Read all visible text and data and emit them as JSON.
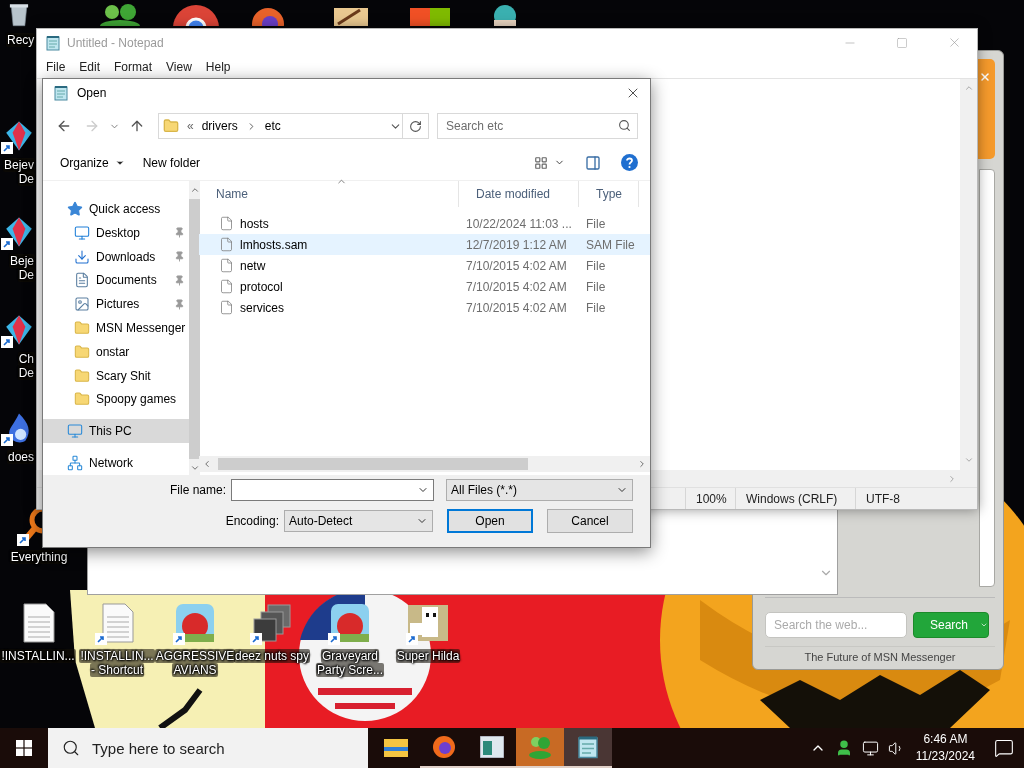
{
  "desktop": {
    "icons": [
      {
        "kind": "recycle",
        "shortcut": false,
        "lines": [
          "Recy"
        ]
      },
      {
        "kind": "gem",
        "shortcut": true,
        "lines": [
          "Bejev",
          "De"
        ]
      },
      {
        "kind": "gem",
        "shortcut": true,
        "lines": [
          "Beje",
          "De"
        ]
      },
      {
        "kind": "gem",
        "shortcut": true,
        "lines": [
          "Ch",
          "De"
        ]
      },
      {
        "kind": "flame",
        "shortcut": true,
        "lines": [
          "does"
        ]
      },
      {
        "kind": "search",
        "shortcut": true,
        "lines": [
          "Everything"
        ]
      },
      {
        "kind": "document",
        "shortcut": false,
        "lines": [
          "!INSTALLIN..."
        ]
      },
      {
        "kind": "document",
        "shortcut": true,
        "lines": [
          "!INSTALLIN...",
          "- Shortcut"
        ]
      },
      {
        "kind": "game",
        "shortcut": true,
        "lines": [
          "AGGRESSIVE",
          "AVIANS"
        ]
      },
      {
        "kind": "stack",
        "shortcut": true,
        "lines": [
          "deez nuts spy"
        ]
      },
      {
        "kind": "game",
        "shortcut": true,
        "lines": [
          "Graveyard",
          "Party Scre..."
        ]
      },
      {
        "kind": "pixel",
        "shortcut": true,
        "lines": [
          "Super Hilda"
        ]
      }
    ]
  },
  "msn_window": {
    "search": {
      "placeholder": "Search the web..."
    },
    "search_button": "Search",
    "footer": "The Future of MSN Messenger"
  },
  "notepad": {
    "title": "Untitled - Notepad",
    "active": false,
    "menu": [
      "File",
      "Edit",
      "Format",
      "View",
      "Help"
    ],
    "status_bar": [
      "100%",
      "Windows (CRLF)",
      "UTF-8"
    ]
  },
  "open_dialog": {
    "title": "Open",
    "address": {
      "overflow_mark": "«",
      "crumbs": [
        "drivers",
        "etc"
      ]
    },
    "search": {
      "placeholder": "Search etc"
    },
    "toolbar": {
      "organize": "Organize",
      "new_folder": "New folder"
    },
    "nav": [
      {
        "label": "Quick access",
        "kind": "star",
        "selected": false,
        "children": [
          {
            "label": "Desktop",
            "kind": "desktop",
            "pinned": true,
            "selected": false
          },
          {
            "label": "Downloads",
            "kind": "download",
            "pinned": true,
            "selected": false
          },
          {
            "label": "Documents",
            "kind": "document",
            "pinned": true,
            "selected": false
          },
          {
            "label": "Pictures",
            "kind": "picture",
            "pinned": true,
            "selected": false
          },
          {
            "label": "MSN Messenger",
            "kind": "folder",
            "pinned": false,
            "selected": false
          },
          {
            "label": "onstar",
            "kind": "folder",
            "pinned": false,
            "selected": false
          },
          {
            "label": "Scary Shit",
            "kind": "folder",
            "pinned": false,
            "selected": false
          },
          {
            "label": "Spoopy games",
            "kind": "folder",
            "pinned": false,
            "selected": false
          }
        ]
      },
      {
        "label": "This PC",
        "kind": "pc",
        "selected": true
      },
      {
        "label": "Network",
        "kind": "network",
        "selected": false
      }
    ],
    "columns": [
      "Name",
      "Date modified",
      "Type"
    ],
    "files": [
      {
        "name": "hosts",
        "date": "10/22/2024 11:03 ...",
        "type": "File",
        "hovered": false
      },
      {
        "name": "lmhosts.sam",
        "date": "12/7/2019 1:12 AM",
        "type": "SAM File",
        "hovered": true
      },
      {
        "name": "netw",
        "date": "7/10/2015 4:02 AM",
        "type": "File",
        "hovered": false
      },
      {
        "name": "protocol",
        "date": "7/10/2015 4:02 AM",
        "type": "File",
        "hovered": false
      },
      {
        "name": "services",
        "date": "7/10/2015 4:02 AM",
        "type": "File",
        "hovered": false
      }
    ],
    "file_name_label": "File name:",
    "filter": "All Files (*.*)",
    "encoding_label": "Encoding:",
    "encoding": "Auto-Detect",
    "buttons": [
      "Open",
      "Cancel"
    ]
  },
  "taskbar": {
    "search_placeholder": "Type here to search",
    "apps": [
      {
        "kind": "explorer",
        "running": false,
        "active": false,
        "flashing": false
      },
      {
        "kind": "firefox",
        "running": true,
        "active": false,
        "flashing": false
      },
      {
        "kind": "app",
        "running": true,
        "active": false,
        "flashing": false
      },
      {
        "kind": "msn",
        "running": true,
        "active": false,
        "flashing": true
      },
      {
        "kind": "notepad",
        "running": true,
        "active": true,
        "flashing": false
      }
    ],
    "time": "6:46 AM",
    "date": "11/23/2024"
  }
}
